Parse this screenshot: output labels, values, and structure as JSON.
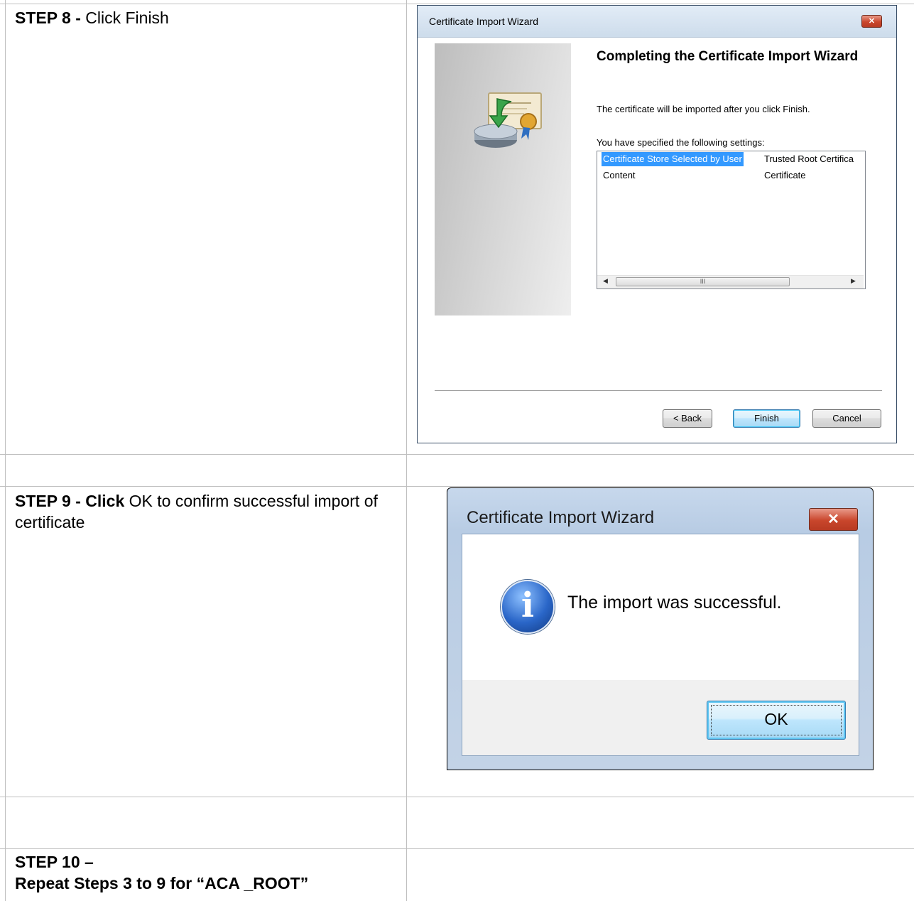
{
  "step8": {
    "label": "STEP 8 - ",
    "text": "Click Finish"
  },
  "wizard1": {
    "title": "Certificate Import Wizard",
    "heading": "Completing the Certificate Import Wizard",
    "message": "The certificate will be imported after you click Finish.",
    "settings_label": "You have specified the following settings:",
    "settings": [
      {
        "name": "Certificate Store Selected by User",
        "value": "Trusted Root Certifica"
      },
      {
        "name": "Content",
        "value": "Certificate"
      }
    ],
    "scroll_grip": "III",
    "buttons": {
      "back": "< Back",
      "finish": "Finish",
      "cancel": "Cancel"
    }
  },
  "step9": {
    "label": "STEP 9 - Click",
    "text": "OK to confirm successful import of certificate"
  },
  "wizard2": {
    "title": "Certificate Import Wizard",
    "message": "The import was successful.",
    "icon_glyph": "i",
    "ok": "OK"
  },
  "step10": {
    "line1": "STEP 10 –",
    "line2": "Repeat Steps 3 to 9 for “ACA _ROOT”"
  }
}
